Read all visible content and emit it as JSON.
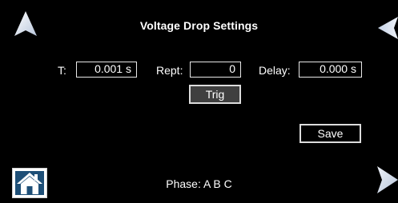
{
  "screen": {
    "title": "Voltage Drop Settings",
    "fields": {
      "t": {
        "label": "T:",
        "value": "0.001 s"
      },
      "rept": {
        "label": "Rept:",
        "value": "0"
      },
      "delay": {
        "label": "Delay:",
        "value": "0.000 s"
      }
    },
    "buttons": {
      "trig_label": "Trig",
      "save_label": "Save"
    },
    "phase": "Phase: A B C"
  },
  "icons": {
    "nav_up": "arrow-up-icon",
    "nav_left": "arrow-left-icon",
    "nav_right": "arrow-right-icon",
    "home": "home-icon"
  },
  "colors": {
    "background": "#000000",
    "text": "#ffffff",
    "border": "#e8e8e8",
    "trig_fill": "#3f3f3f",
    "home_bg": "#1e4f77",
    "arrow": "#dfe6f2"
  }
}
